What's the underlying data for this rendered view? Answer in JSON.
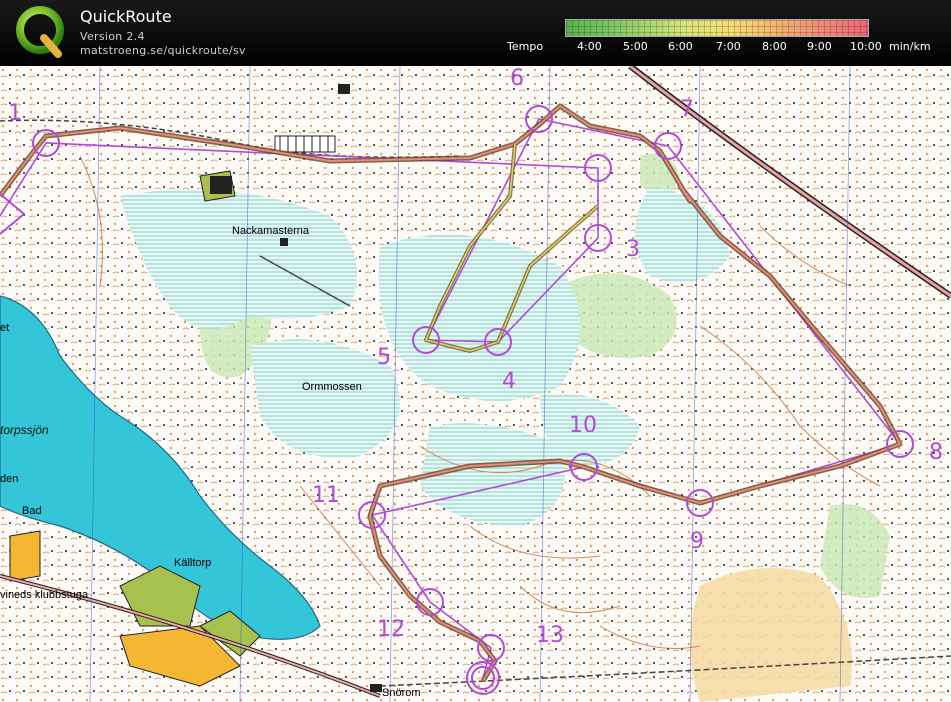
{
  "app": {
    "title": "QuickRoute",
    "version": "Version 2.4",
    "url": "matstroeng.se/quickroute/sv"
  },
  "legend": {
    "label": "Tempo",
    "unit": "min/km",
    "ticks": [
      "4:00",
      "5:00",
      "6:00",
      "7:00",
      "8:00",
      "9:00",
      "10:00"
    ],
    "colors": {
      "fast": "#58b04a",
      "slow": "#ec6472"
    }
  },
  "map": {
    "controls": [
      {
        "label": "1"
      },
      {
        "label": "3"
      },
      {
        "label": "4"
      },
      {
        "label": "5"
      },
      {
        "label": "6"
      },
      {
        "label": "7"
      },
      {
        "label": "8"
      },
      {
        "label": "9"
      },
      {
        "label": "10"
      },
      {
        "label": "11"
      },
      {
        "label": "12"
      },
      {
        "label": "13"
      }
    ],
    "place_names": {
      "nackamasterna": "Nackamasterna",
      "ormmossen": "Ormmossen",
      "torpssjon": "torpssjön",
      "bad": "Bad",
      "kalltorp": "Källtorp",
      "klubbstuga": "vineds klubbstuga",
      "snorom": "Snörom",
      "den": "den",
      "et": "et"
    },
    "course_color": "#b04bd8",
    "route_color": "#9a6b3a"
  }
}
